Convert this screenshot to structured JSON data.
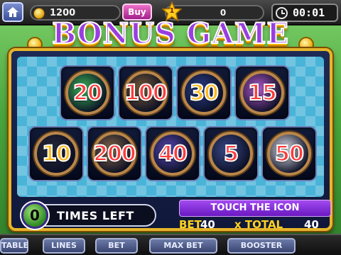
{
  "hud": {
    "coins": "1200",
    "buy_label": "Buy",
    "level": "1",
    "xp": "0",
    "timer": "00:01"
  },
  "title": "BONUS GAME",
  "tiles": [
    {
      "value": "20",
      "fill": "#ff3b3b",
      "glow": "#3bb85a"
    },
    {
      "value": "100",
      "fill": "#ff3b3b",
      "glow": "#7a5c3a"
    },
    {
      "value": "30",
      "fill": "#ffb81a",
      "glow": "#2b3f8a"
    },
    {
      "value": "15",
      "fill": "#ff3b3b",
      "glow": "#b85ad0"
    },
    {
      "value": "10",
      "fill": "#ffb81a",
      "glow": "#2a2a3a"
    },
    {
      "value": "200",
      "fill": "#ff3b3b",
      "glow": "#8a6a4a"
    },
    {
      "value": "40",
      "fill": "#ff3b3b",
      "glow": "#5a4ab8"
    },
    {
      "value": "5",
      "fill": "#ff3b3b",
      "glow": "#3a4a8a"
    },
    {
      "value": "50",
      "fill": "#ff3b3b",
      "glow": "#e8e8f0"
    }
  ],
  "bonus": {
    "times_left": "0",
    "times_left_label": "TIMES LEFT",
    "instruction": "TOUCH THE ICON",
    "bet_label": "BET",
    "bet_value": "40",
    "total_label": "x TOTAL",
    "total_value": "40"
  },
  "nav": [
    "TABLE",
    "LINES",
    "BET",
    "MAX BET",
    "BOOSTER"
  ]
}
